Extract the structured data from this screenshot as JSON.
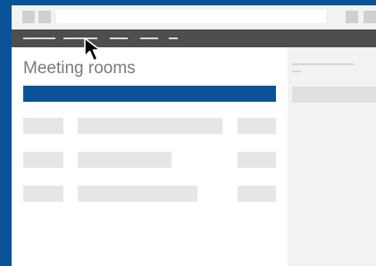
{
  "window": {
    "titlebar": {
      "buttons_left": [
        "nav-back-icon",
        "nav-forward-icon"
      ],
      "buttons_right": [
        "minimize-icon",
        "close-icon"
      ]
    },
    "menubar": {
      "items": [
        "menu-item-1",
        "menu-item-2",
        "menu-item-3",
        "menu-item-4",
        "menu-item-5"
      ]
    }
  },
  "main": {
    "page_title": "Meeting rooms"
  },
  "colors": {
    "brand": "#0a5298",
    "menubar": "#4e4e4e",
    "placeholder": "#e6e6e6"
  },
  "cursor": "arrow-cursor-icon"
}
